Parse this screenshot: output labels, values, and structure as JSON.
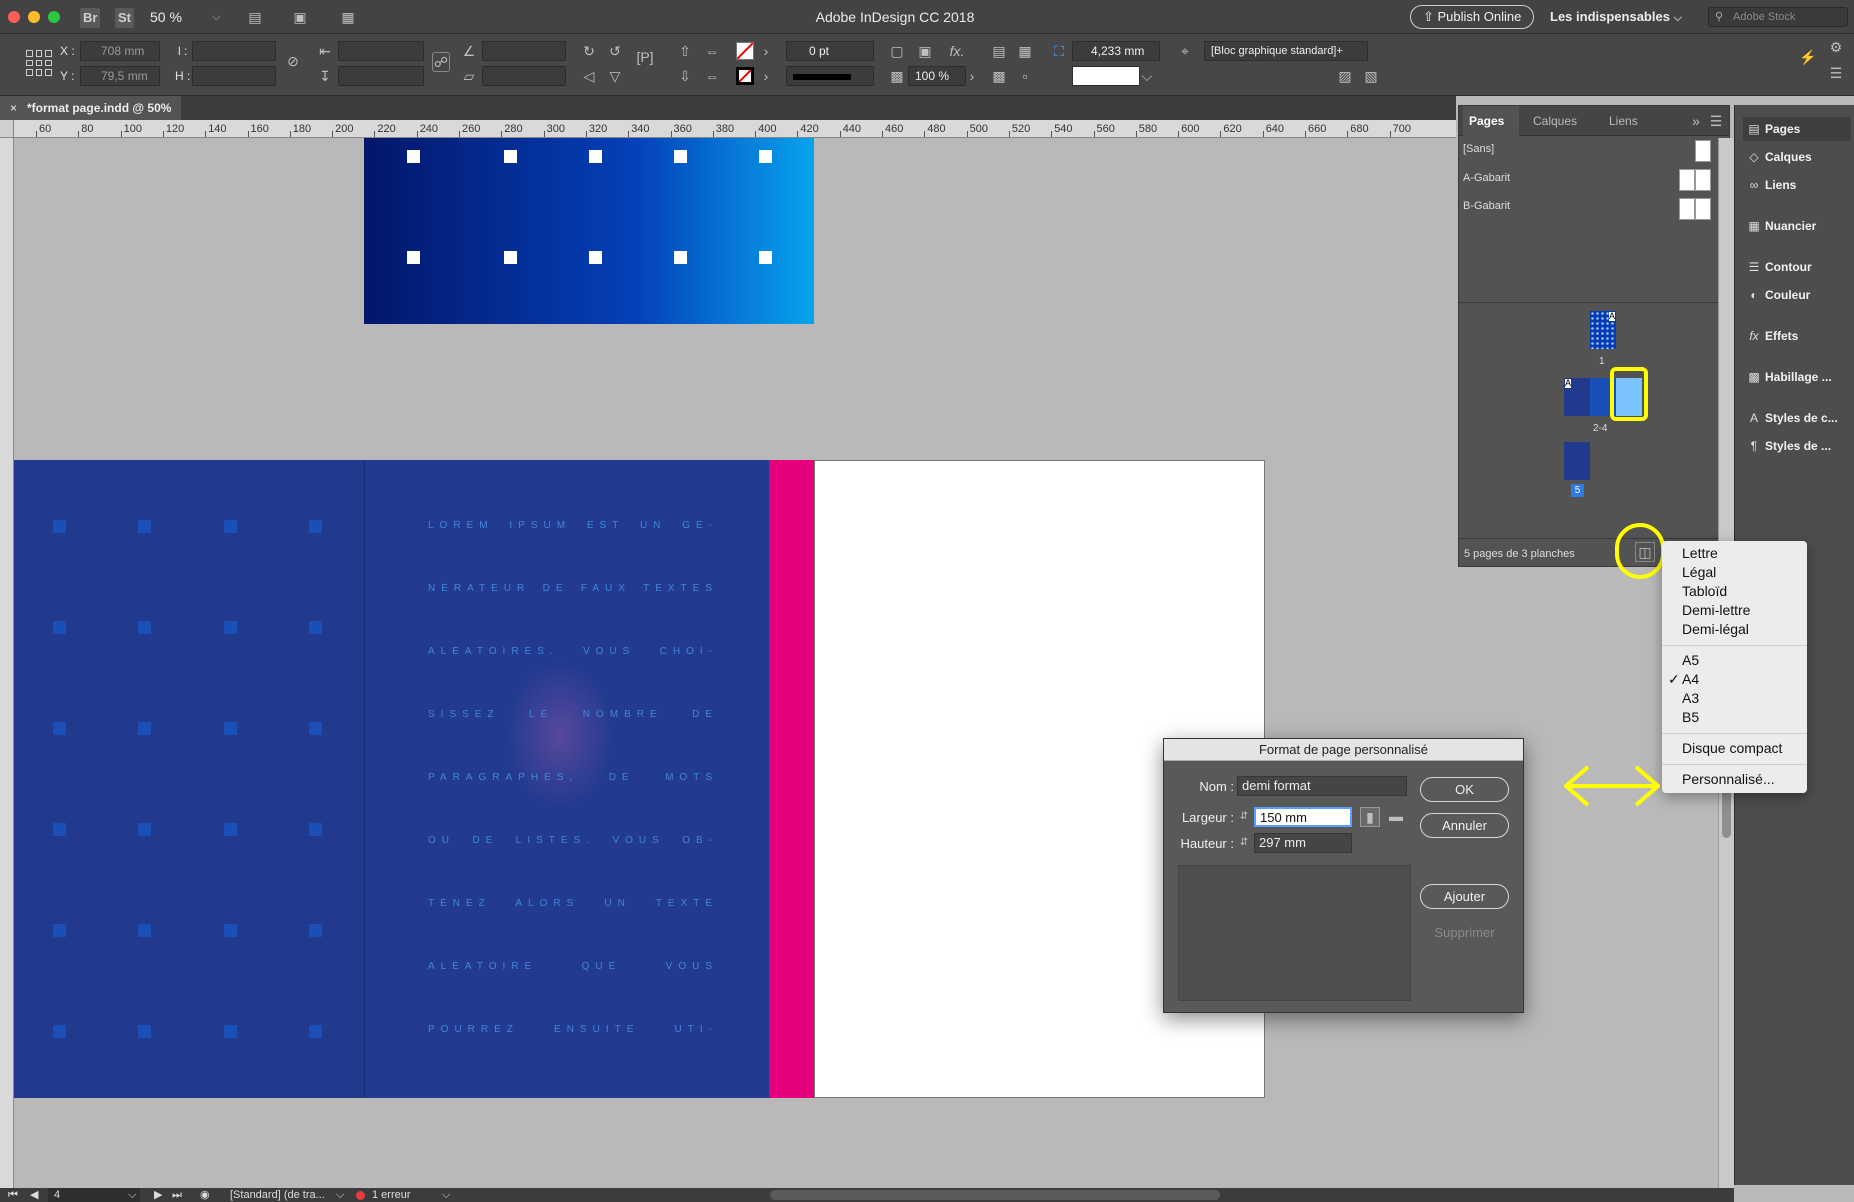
{
  "window": {
    "title": "Adobe InDesign CC 2018",
    "zoom": "50 %",
    "bridge_label": "Br",
    "stock_label": "St"
  },
  "topbar": {
    "publish_label": "Publish Online",
    "workspace": "Les indispensables",
    "search_placeholder": "Adobe Stock"
  },
  "control": {
    "x_label": "X :",
    "x_value": "708 mm",
    "y_label": "Y :",
    "y_value": "79,5 mm",
    "l_label": "l :",
    "h_label": "H :",
    "stroke_weight": "0 pt",
    "scale": "100 %",
    "offset": "4,233 mm",
    "object_style": "[Bloc graphique standard]+"
  },
  "document_tab": {
    "label": "*format page.indd @ 50%",
    "close": "×"
  },
  "ruler": {
    "labels": [
      "60",
      "80",
      "100",
      "120",
      "140",
      "160",
      "180",
      "200",
      "220",
      "240",
      "260",
      "280",
      "300",
      "320",
      "340",
      "360",
      "380",
      "400",
      "420",
      "440",
      "460",
      "480",
      "500",
      "520",
      "540",
      "560",
      "580",
      "600",
      "620",
      "640",
      "660",
      "680",
      "700"
    ]
  },
  "lorem_lines": [
    "LOREM IPSUM EST UN GÉ-",
    "NÉRATEUR DE FAUX TEXTES",
    "ALÉATOIRES. VOUS CHOI-",
    "SISSEZ LE NOMBRE DE",
    "PARAGRAPHES, DE MOTS",
    "OU DE LISTES. VOUS OB-",
    "TENEZ ALORS UN TEXTE",
    "ALÉATOIRE QUE VOUS",
    "POURREZ ENSUITE UTI-"
  ],
  "pages_panel": {
    "tabs": [
      "Pages",
      "Calques",
      "Liens"
    ],
    "masters": [
      "[Sans]",
      "A-Gabarit",
      "B-Gabarit"
    ],
    "spread_labels": [
      "1",
      "2-4",
      "5"
    ],
    "thumb_master_letter": "A",
    "footer": "5 pages de 3 planches"
  },
  "dock": {
    "items": [
      "Pages",
      "Calques",
      "Liens",
      "Nuancier",
      "Contour",
      "Couleur",
      "Effets",
      "Habillage ...",
      "Styles de c...",
      "Styles de ..."
    ]
  },
  "menu": {
    "group1": [
      "Lettre",
      "Légal",
      "Tabloïd",
      "Demi-lettre",
      "Demi-légal"
    ],
    "group2": [
      "A5",
      "A4",
      "A3",
      "B5"
    ],
    "checked": "A4",
    "group3": [
      "Disque compact"
    ],
    "group4": [
      "Personnalisé..."
    ],
    "checkmark": "✓"
  },
  "dialog": {
    "title": "Format de page personnalisé",
    "name_label": "Nom :",
    "name_value": "demi format",
    "width_label": "Largeur :",
    "width_value": "150 mm",
    "height_label": "Hauteur :",
    "height_value": "297 mm",
    "ok": "OK",
    "cancel": "Annuler",
    "add": "Ajouter",
    "delete": "Supprimer"
  },
  "status": {
    "page": "4",
    "style": "[Standard] (de tra...",
    "errors": "1 erreur"
  },
  "colors": {
    "accent": "#ffff00",
    "magenta": "#e6007e",
    "page_blue": "#213a8e",
    "error": "#e63c3c"
  }
}
